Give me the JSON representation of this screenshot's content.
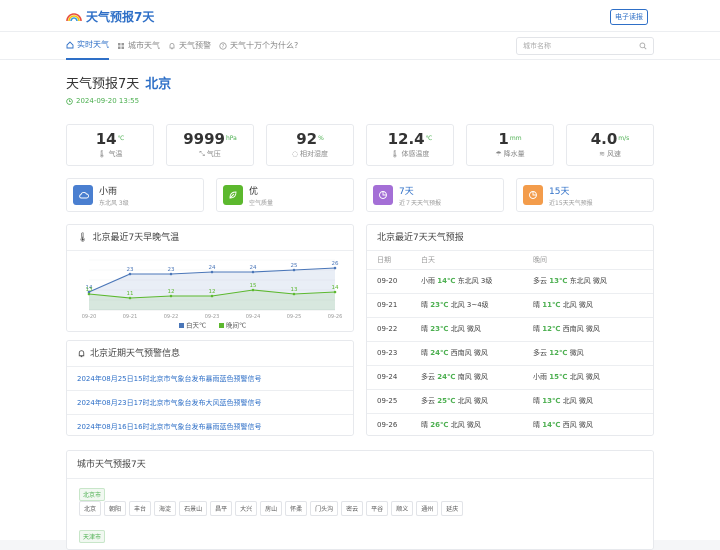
{
  "header": {
    "logo_text": "天气预报7天",
    "ebook_label": "电子读报"
  },
  "nav": {
    "items": [
      {
        "label": "实时天气",
        "icon": "home-icon"
      },
      {
        "label": "城市天气",
        "icon": "grid-icon"
      },
      {
        "label": "天气预警",
        "icon": "bell-icon"
      },
      {
        "label": "天气十万个为什么?",
        "icon": "question-icon"
      }
    ],
    "search_placeholder": "城市名称"
  },
  "page": {
    "title": "天气预报7天",
    "city": "北京",
    "datetime": "2024-09-20 13:55"
  },
  "stats": [
    {
      "value": "14",
      "unit": "℃",
      "label": "气温",
      "icon": "thermometer-icon"
    },
    {
      "value": "9999",
      "unit": "hPa",
      "label": "气压",
      "icon": "pressure-icon"
    },
    {
      "value": "92",
      "unit": "%",
      "label": "相对湿度",
      "icon": "humidity-icon"
    },
    {
      "value": "12.4",
      "unit": "℃",
      "label": "体感温度",
      "icon": "thermometer-icon"
    },
    {
      "value": "1",
      "unit": "mm",
      "label": "降水量",
      "icon": "rain-icon"
    },
    {
      "value": "4.0",
      "unit": "m/s",
      "label": "风速",
      "icon": "wind-icon"
    }
  ],
  "cards": [
    {
      "title": "小雨",
      "sub": "东北风 3级",
      "icon": "cloud-icon",
      "color": "#4a7fd0"
    },
    {
      "title": "优",
      "sub": "空气质量",
      "icon": "leaf-icon",
      "color": "#5cb82e"
    },
    {
      "title": "7天",
      "sub": "近７天天气预报",
      "icon": "pie-icon",
      "color": "#a46fd6"
    },
    {
      "title": "15天",
      "sub": "近15天天气预报",
      "icon": "pie-icon",
      "color": "#f39c4b"
    }
  ],
  "temp_panel": {
    "title": "北京最近7天早晚气温"
  },
  "chart_data": {
    "type": "line",
    "categories": [
      "09-20",
      "09-21",
      "09-22",
      "09-23",
      "09-24",
      "09-25",
      "09-26"
    ],
    "series": [
      {
        "name": "白天℃",
        "values": [
          14,
          23,
          23,
          24,
          24,
          25,
          26
        ],
        "color": "#4a76b8"
      },
      {
        "name": "晚间℃",
        "values": [
          13,
          11,
          12,
          12,
          15,
          13,
          14
        ],
        "color": "#5cb82e"
      }
    ],
    "ylim": [
      5,
      32
    ],
    "grid": true,
    "legend": "bottom"
  },
  "warnings": {
    "title": "北京近期天气预警信息",
    "items": [
      "2024年08月25日15时北京市气象台发布暴雨蓝色预警信号",
      "2024年08月23日17时北京市气象台发布大风蓝色预警信号",
      "2024年08月16日16时北京市气象台发布暴雨蓝色预警信号"
    ]
  },
  "forecast": {
    "title": "北京最近7天天气预报",
    "headers": [
      "日期",
      "白天",
      "晚间"
    ],
    "rows": [
      {
        "date": "09-20",
        "day_w": "小雨",
        "day_t": "14℃",
        "day_wind": "东北风 3级",
        "night_w": "多云",
        "night_t": "13℃",
        "night_wind": "东北风 微风"
      },
      {
        "date": "09-21",
        "day_w": "晴",
        "day_t": "23℃",
        "day_wind": "北风 3~4级",
        "night_w": "晴",
        "night_t": "11℃",
        "night_wind": "北风 微风"
      },
      {
        "date": "09-22",
        "day_w": "晴",
        "day_t": "23℃",
        "day_wind": "北风 微风",
        "night_w": "晴",
        "night_t": "12℃",
        "night_wind": "西南风 微风"
      },
      {
        "date": "09-23",
        "day_w": "晴",
        "day_t": "24℃",
        "day_wind": "西南风 微风",
        "night_w": "多云",
        "night_t": "12℃",
        "night_wind": "微风"
      },
      {
        "date": "09-24",
        "day_w": "多云",
        "day_t": "24℃",
        "day_wind": "南风 微风",
        "night_w": "小雨",
        "night_t": "15℃",
        "night_wind": "北风 微风"
      },
      {
        "date": "09-25",
        "day_w": "多云",
        "day_t": "25℃",
        "day_wind": "北风 微风",
        "night_w": "晴",
        "night_t": "13℃",
        "night_wind": "北风 微风"
      },
      {
        "date": "09-26",
        "day_w": "晴",
        "day_t": "26℃",
        "day_wind": "北风 微风",
        "night_w": "晴",
        "night_t": "14℃",
        "night_wind": "西风 微风"
      }
    ]
  },
  "city_section": {
    "title": "城市天气预报7天",
    "regions": [
      {
        "name": "北京市",
        "districts": [
          "北京",
          "朝阳",
          "丰台",
          "海淀",
          "石景山",
          "昌平",
          "大兴",
          "房山",
          "怀柔",
          "门头沟",
          "密云",
          "平谷",
          "顺义",
          "通州",
          "延庆"
        ]
      },
      {
        "name": "天津市",
        "districts": []
      }
    ]
  }
}
